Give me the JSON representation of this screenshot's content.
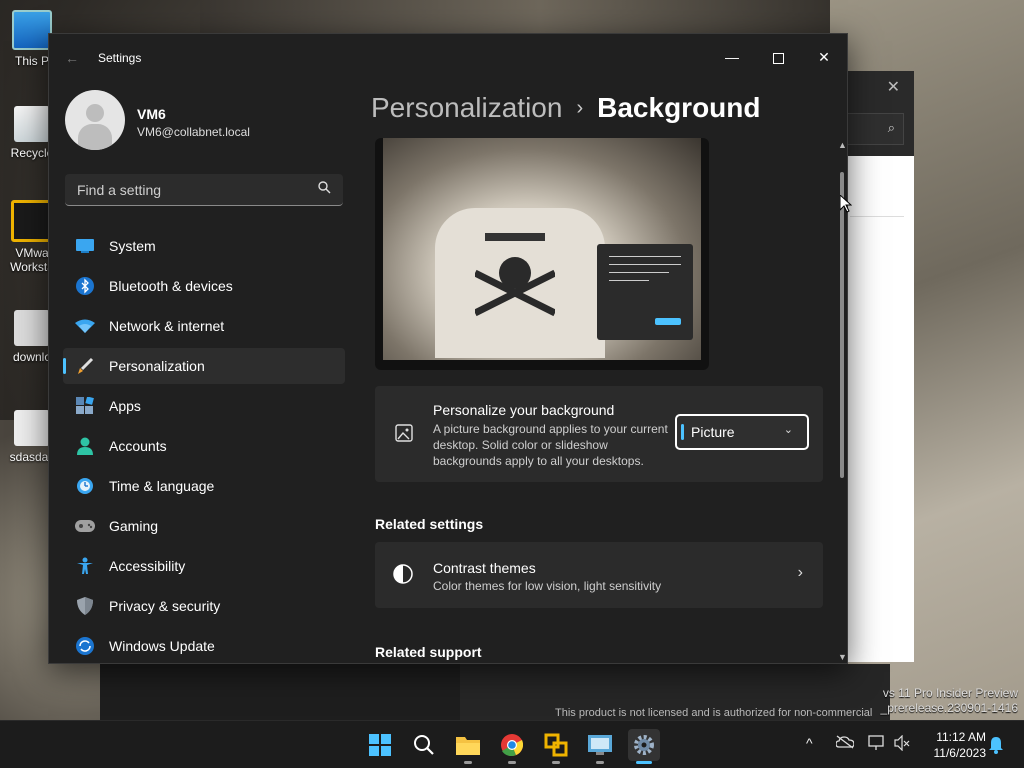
{
  "desktop": {
    "icons": [
      {
        "label": "This P"
      },
      {
        "label": "Recycle"
      },
      {
        "label": "VMwa\nWorksta"
      },
      {
        "label": "downlo"
      },
      {
        "label": "sdasdas"
      }
    ]
  },
  "window": {
    "app_title": "Settings",
    "min_glyph": "—",
    "close_glyph": "✕",
    "back_glyph": "←"
  },
  "account": {
    "name": "VM6",
    "email": "VM6@collabnet.local"
  },
  "search": {
    "placeholder": "Find a setting"
  },
  "nav": {
    "items": [
      {
        "label": "System",
        "icon": "monitor-icon"
      },
      {
        "label": "Bluetooth & devices",
        "icon": "bluetooth-icon"
      },
      {
        "label": "Network & internet",
        "icon": "wifi-icon"
      },
      {
        "label": "Personalization",
        "icon": "brush-icon",
        "selected": true
      },
      {
        "label": "Apps",
        "icon": "apps-icon"
      },
      {
        "label": "Accounts",
        "icon": "person-icon"
      },
      {
        "label": "Time & language",
        "icon": "globe-clock-icon"
      },
      {
        "label": "Gaming",
        "icon": "gamepad-icon"
      },
      {
        "label": "Accessibility",
        "icon": "accessibility-icon"
      },
      {
        "label": "Privacy & security",
        "icon": "shield-icon"
      },
      {
        "label": "Windows Update",
        "icon": "update-icon"
      }
    ]
  },
  "breadcrumb": {
    "parent": "Personalization",
    "separator": "›",
    "current": "Background"
  },
  "background_card": {
    "title": "Personalize your background",
    "description": "A picture background applies to your current desktop. Solid color or slideshow backgrounds apply to all your desktops.",
    "dropdown_value": "Picture",
    "dropdown_chevron": "⌄"
  },
  "related_settings": {
    "heading": "Related settings",
    "contrast": {
      "title": "Contrast themes",
      "description": "Color themes for low vision, light sensitivity",
      "chevron": "›"
    }
  },
  "related_support": {
    "heading": "Related support"
  },
  "behind": {
    "license_text": "This product is not licensed and is authorized for non-commercial",
    "watermark_line1": "vs 11 Pro Insider Preview",
    "watermark_line2": "_prerelease.230901-1416"
  },
  "taskbar": {
    "tray_overflow": "^",
    "time": "11:12 AM",
    "date": "11/6/2023"
  },
  "colors": {
    "accent": "#4cc2ff",
    "window_bg": "#202020",
    "card_bg": "#2b2b2b"
  }
}
